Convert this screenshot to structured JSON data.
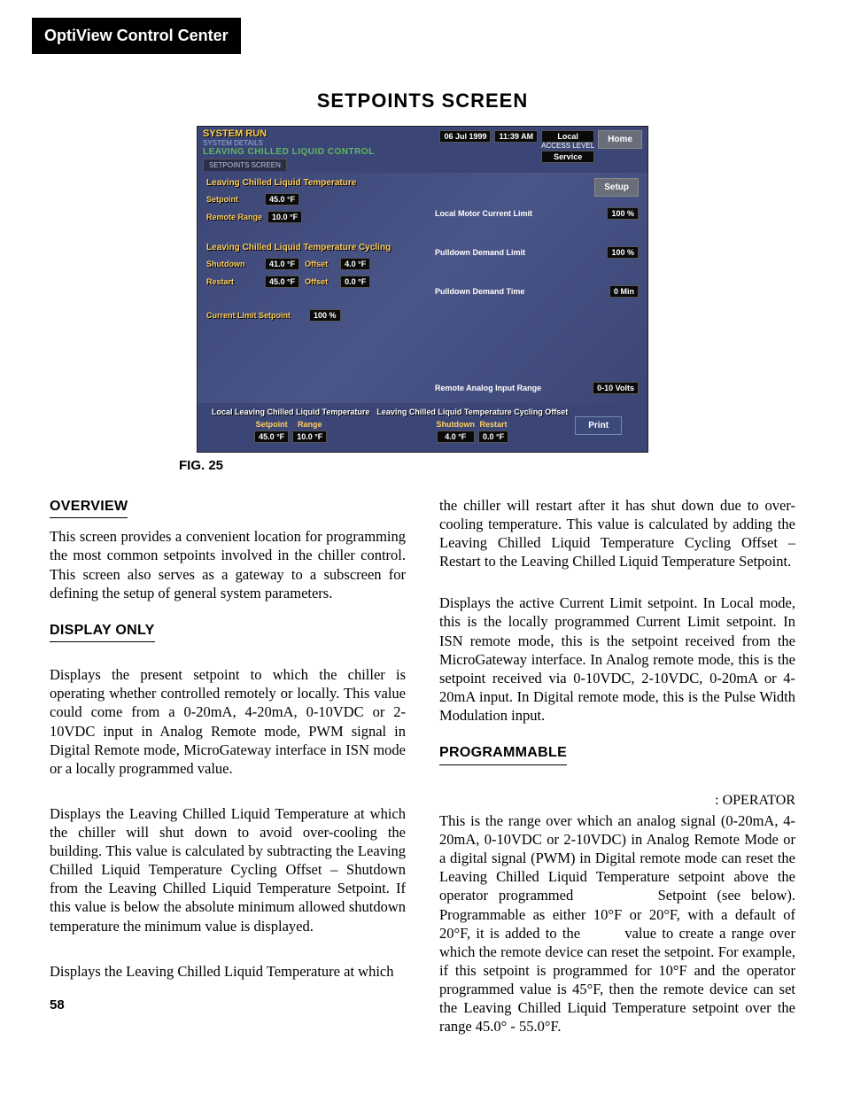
{
  "header": {
    "product": "OptiView Control Center"
  },
  "title": "SETPOINTS SCREEN",
  "figure_label": "FIG. 25",
  "page_number": "58",
  "screenshot": {
    "status": "SYSTEM RUN",
    "substatus": "SYSTEM DETAILS",
    "screen_title": "LEAVING CHILLED LIQUID CONTROL",
    "tab": "SETPOINTS SCREEN",
    "date": "06 Jul 1999",
    "time": "11:39 AM",
    "source_label": "Local",
    "access_caption": "ACCESS LEVEL",
    "access_level": "Service",
    "home_btn": "Home",
    "setup_btn": "Setup",
    "left": {
      "grp1_title": "Leaving Chilled Liquid Temperature",
      "setpoint_label": "Setpoint",
      "setpoint_value": "45.0 °F",
      "remote_range_label": "Remote Range",
      "remote_range_value": "10.0 °F",
      "grp2_title": "Leaving Chilled Liquid Temperature Cycling",
      "shutdown_label": "Shutdown",
      "shutdown_value": "41.0 °F",
      "shutdown_offset_label": "Offset",
      "shutdown_offset_value": "4.0 °F",
      "restart_label": "Restart",
      "restart_value": "45.0 °F",
      "restart_offset_label": "Offset",
      "restart_offset_value": "0.0 °F",
      "current_limit_label": "Current Limit Setpoint",
      "current_limit_value": "100 %"
    },
    "right": {
      "local_motor_label": "Local Motor Current Limit",
      "local_motor_value": "100 %",
      "pulldown_demand_label": "Pulldown Demand Limit",
      "pulldown_demand_value": "100 %",
      "pulldown_time_label": "Pulldown Demand Time",
      "pulldown_time_value": "0 Min",
      "remote_analog_label": "Remote Analog Input Range",
      "remote_analog_value": "0-10 Volts"
    },
    "bottom": {
      "grp1_caption": "Local Leaving Chilled Liquid Temperature",
      "grp1_setpoint_label": "Setpoint",
      "grp1_setpoint_value": "45.0 °F",
      "grp1_range_label": "Range",
      "grp1_range_value": "10.0 °F",
      "grp2_caption": "Leaving Chilled Liquid Temperature Cycling Offset",
      "grp2_shutdown_label": "Shutdown",
      "grp2_shutdown_value": "4.0 °F",
      "grp2_restart_label": "Restart",
      "grp2_restart_value": "0.0 °F",
      "print_btn": "Print"
    }
  },
  "text": {
    "overview_head": "OVERVIEW",
    "overview_body": "This screen provides a convenient location for programming the most common setpoints involved in the chiller control. This screen also serves as a gateway to a subscreen for defining the setup of general system parameters.",
    "display_only_head": "DISPLAY ONLY",
    "display_p1": "Displays the present setpoint to which the chiller is operating whether controlled remotely or locally. This value could come from a 0-20mA, 4-20mA, 0-10VDC or 2-10VDC input in Analog Remote mode, PWM signal in Digital Remote mode, MicroGateway interface in ISN mode or a locally programmed value.",
    "display_p2": "Displays the Leaving Chilled Liquid Temperature at which the chiller will shut down to avoid over-cooling the building. This value is calculated by subtracting the Leaving Chilled Liquid Temperature Cycling Offset – Shutdown from the Leaving Chilled Liquid Temperature Setpoint. If this value is below the absolute minimum allowed shutdown temperature the minimum value is displayed.",
    "display_p3": "Displays the Leaving Chilled Liquid Temperature at which",
    "right_p1": "the chiller will restart after it has shut down due to over-cooling temperature. This value is calculated by adding the Leaving Chilled Liquid Temperature Cycling Offset – Restart to the Leaving Chilled Liquid Temperature Setpoint.",
    "right_p2": "Displays the active Current Limit setpoint. In Local mode, this is the locally programmed Current Limit setpoint. In ISN remote mode, this is the setpoint received from the MicroGateway interface. In Analog remote mode, this is the setpoint received via 0-10VDC, 2-10VDC, 0-20mA or 4-20mA input. In Digital remote mode, this is the Pulse Width Modulation input.",
    "programmable_head": "PROGRAMMABLE",
    "access_level_line": ": OPERATOR",
    "programmable_body": "This is the range over which an analog signal (0-20mA, 4-20mA, 0-10VDC or 2-10VDC) in Analog Remote Mode or a digital signal (PWM) in Digital remote mode can reset the Leaving Chilled Liquid Temperature setpoint above the operator programmed        Setpoint (see below). Programmable as either 10°F or 20°F, with a default of 20°F, it is added to the        value to create a range over which the remote device can reset the setpoint. For example, if this setpoint is programmed for 10°F and the operator programmed value is 45°F, then the remote device can set the Leaving Chilled Liquid Temperature setpoint over the range 45.0° - 55.0°F."
  }
}
